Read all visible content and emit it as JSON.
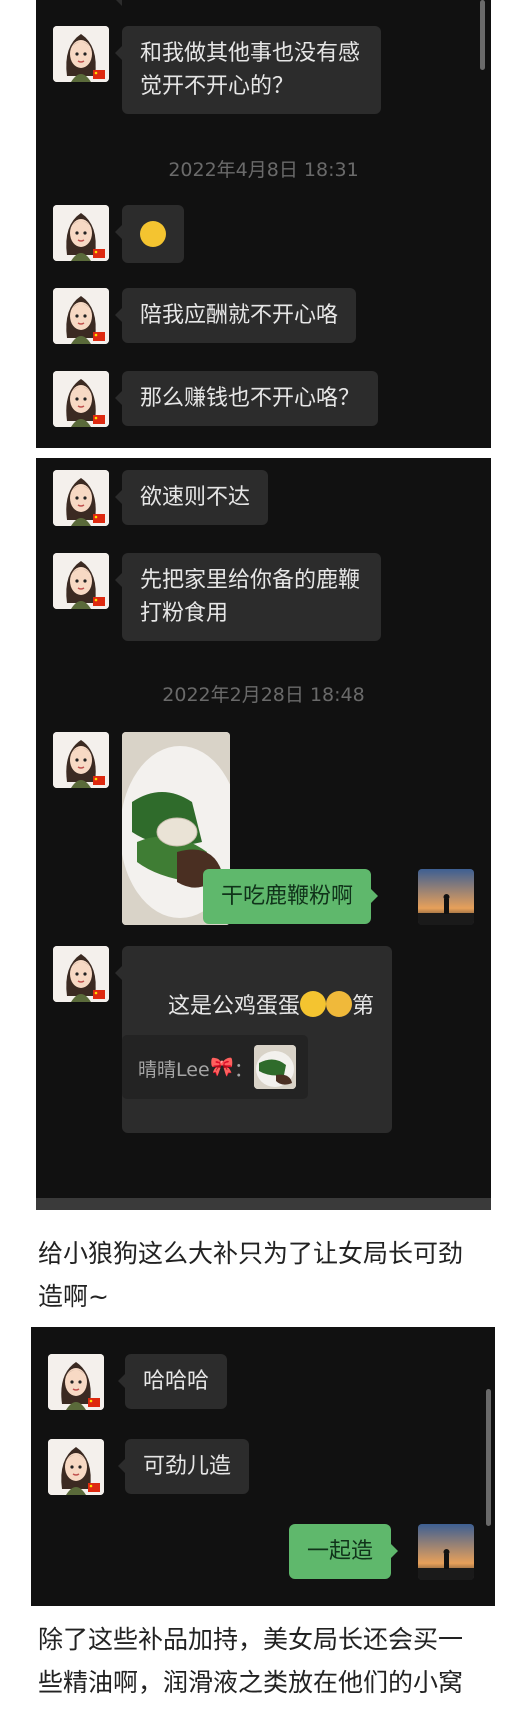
{
  "panel1": {
    "messages": [
      {
        "text": "和我做其他事也没有感\n觉开不开心的？"
      },
      {
        "text": "陪我应酬就不开心咯"
      },
      {
        "text": "那么赚钱也不开心咯？"
      }
    ],
    "timestamp": "2022年4月8日 18:31",
    "emoji_message": "confused-face-emoji"
  },
  "panel2": {
    "messages": [
      {
        "text": "欲速则不达"
      },
      {
        "text": "先把家里给你备的鹿鞭\n打粉食用"
      },
      {
        "text": "干吃鹿鞭粉啊"
      },
      {
        "text": "这是公鸡蛋蛋"
      },
      {
        "text": "第一\n次吃"
      }
    ],
    "timestamp": "2022年2月28日 18:48",
    "quote": {
      "sender": "晴晴Lee",
      "separator": "：",
      "icon": "bow-emoji"
    }
  },
  "caption1": "给小狼狗这么大补只为了让女局长可劲\n造啊~",
  "panel3": {
    "messages": [
      {
        "text": "哈哈哈"
      },
      {
        "text": "可劲儿造"
      },
      {
        "text": "一起造"
      }
    ]
  },
  "caption2": "除了这些补品加持，美女局长还会买一\n些精油啊，润滑液之类放在他们的小窝",
  "colors": {
    "chat_background": "#111111",
    "incoming_bubble": "#2c2c2c",
    "outgoing_bubble": "#5fb86c",
    "timestamp_text": "#6a6a6a"
  }
}
